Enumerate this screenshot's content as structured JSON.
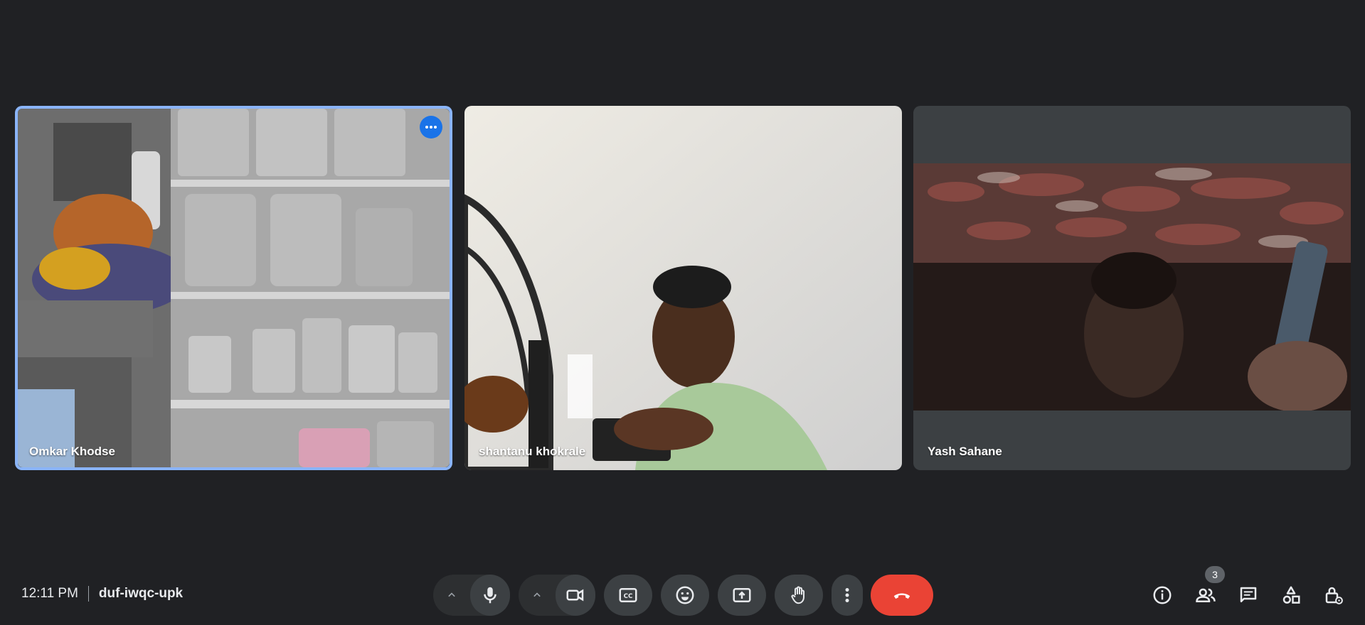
{
  "participants": [
    {
      "name": "Omkar Khodse"
    },
    {
      "name": "shantanu khokrale"
    },
    {
      "name": "Yash Sahane"
    }
  ],
  "meeting": {
    "time": "12:11 PM",
    "code": "duf-iwqc-upk"
  },
  "people_count": "3",
  "colors": {
    "background": "#202124",
    "tile": "#3c4043",
    "active_border": "#8ab4f8",
    "accent": "#1a73e8",
    "end_call": "#ea4335"
  },
  "icons": [
    "more-options-icon",
    "mic-icon",
    "camera-icon",
    "captions-icon",
    "emoji-icon",
    "present-icon",
    "raise-hand-icon",
    "more-vert-icon",
    "end-call-icon",
    "info-icon",
    "people-icon",
    "chat-icon",
    "activities-icon",
    "host-controls-icon",
    "chevron-up-icon"
  ]
}
